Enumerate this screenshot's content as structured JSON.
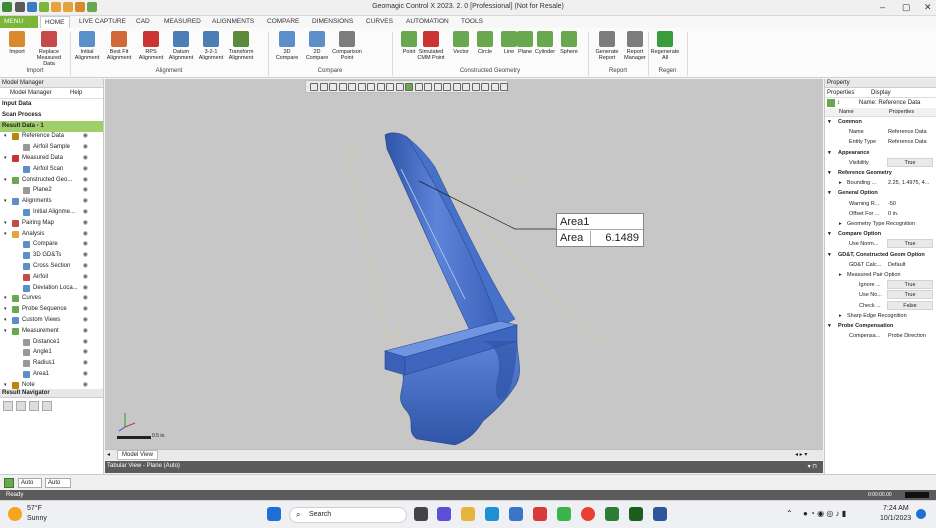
{
  "app": {
    "title": "Geomagic Control X 2023. 2. 0 [Professional] (Not for Resale)"
  },
  "tabs": [
    "MENU",
    "HOME",
    "LIVE CAPTURE",
    "CAD",
    "MEASURED",
    "ALIGNMENTS",
    "COMPARE",
    "DIMENSIONS",
    "CURVES",
    "AUTOMATION",
    "TOOLS"
  ],
  "ribbon": {
    "buttons": [
      {
        "label": "Import",
        "color": "#d98a2a"
      },
      {
        "label": "Replace Measured Data",
        "color": "#c74a4a"
      },
      {
        "label": "Initial Alignment",
        "color": "#5b8fc7"
      },
      {
        "label": "Best Fit Alignment",
        "color": "#d06a3a"
      },
      {
        "label": "RPS Alignment",
        "color": "#c33"
      },
      {
        "label": "Datum Alignment",
        "color": "#4a7fb5"
      },
      {
        "label": "3-2-1 Alignment",
        "color": "#4a7fb5"
      },
      {
        "label": "Transform Alignment",
        "color": "#5c8a3a"
      },
      {
        "label": "3D Compare",
        "color": "#5b8fc7"
      },
      {
        "label": "2D Compare",
        "color": "#5b8fc7"
      },
      {
        "label": "Comparison Point",
        "color": "#7d7d7d"
      },
      {
        "label": "Point",
        "color": "#6aa84f"
      },
      {
        "label": "Simulated CMM Point",
        "color": "#c33"
      },
      {
        "label": "Vector",
        "color": "#6aa84f"
      },
      {
        "label": "Circle",
        "color": "#6aa84f"
      },
      {
        "label": "Line",
        "color": "#6aa84f"
      },
      {
        "label": "Plane",
        "color": "#6aa84f"
      },
      {
        "label": "Cylinder",
        "color": "#6aa84f"
      },
      {
        "label": "Sphere",
        "color": "#6aa84f"
      },
      {
        "label": "Generate Report",
        "color": "#7d7d7d"
      },
      {
        "label": "Report Manager",
        "color": "#7d7d7d"
      },
      {
        "label": "Regenerate All",
        "color": "#3b9c3b"
      }
    ],
    "groups": [
      "Import",
      "Alignment",
      "Compare",
      "Constructed Geometry",
      "Report",
      "Regen"
    ]
  },
  "left_panel": {
    "title": "Model Manager",
    "tabs": [
      "Model Manager",
      "Help"
    ],
    "rows": [
      {
        "label": "Input Data",
        "type": "section"
      },
      {
        "label": "Scan Process",
        "type": "section"
      },
      {
        "label": "Result Data - 1",
        "type": "selected"
      },
      {
        "label": "Reference Data",
        "indent": 1,
        "color": "#b8860b"
      },
      {
        "label": "Airfoil Sample",
        "indent": 2,
        "color": "#999"
      },
      {
        "label": "Measured Data",
        "indent": 1,
        "color": "#c33"
      },
      {
        "label": "Airfoil Scan",
        "indent": 2,
        "color": "#5b8fc7"
      },
      {
        "label": "Constructed Geo...",
        "indent": 1,
        "color": "#6aa84f"
      },
      {
        "label": "Plane2",
        "indent": 2,
        "color": "#999"
      },
      {
        "label": "Alignments",
        "indent": 1,
        "color": "#5b8fc7"
      },
      {
        "label": "Initial Alignme...",
        "indent": 2,
        "color": "#5b8fc7"
      },
      {
        "label": "Pairing Map",
        "indent": 1,
        "color": "#c74a4a"
      },
      {
        "label": "Analysis",
        "indent": 1,
        "color": "#e6a23c"
      },
      {
        "label": "Compare",
        "indent": 2,
        "color": "#5b8fc7"
      },
      {
        "label": "3D GD&Ts",
        "indent": 2,
        "color": "#5b8fc7"
      },
      {
        "label": "Cross Section",
        "indent": 2,
        "color": "#5b8fc7"
      },
      {
        "label": "Airfoil",
        "indent": 2,
        "color": "#c74a4a"
      },
      {
        "label": "Deviation Loca...",
        "indent": 2,
        "color": "#5b8fc7"
      },
      {
        "label": "Curves",
        "indent": 1,
        "color": "#6aa84f"
      },
      {
        "label": "Probe Sequence",
        "indent": 1,
        "color": "#6aa84f"
      },
      {
        "label": "Custom Views",
        "indent": 1,
        "color": "#5b8fc7"
      },
      {
        "label": "Measurement",
        "indent": 1,
        "color": "#6aa84f"
      },
      {
        "label": "Distance1",
        "indent": 2,
        "color": "#999"
      },
      {
        "label": "Angle1",
        "indent": 2,
        "color": "#999"
      },
      {
        "label": "Radius1",
        "indent": 2,
        "color": "#999"
      },
      {
        "label": "Area1",
        "indent": 2,
        "color": "#5b8fc7"
      },
      {
        "label": "Note",
        "indent": 1,
        "color": "#b8860b"
      }
    ],
    "result_navigator": "Result Navigator"
  },
  "viewport": {
    "annotation": {
      "title": "Area1",
      "key": "Area",
      "value": "6.1489"
    },
    "scale_label": "0.5 in.",
    "tab": "Model View",
    "tabular": "Tabular View - Plane (Auto)"
  },
  "right_panel": {
    "title": "Property",
    "tabs": [
      "Properties",
      "Display"
    ],
    "name_label": "Name: Reference Data",
    "col_name": "Name",
    "col_props": "Properties",
    "rows": [
      {
        "type": "cat",
        "label": "Common"
      },
      {
        "label": "Name",
        "value": "Reference Data"
      },
      {
        "label": "Entity Type",
        "value": "Reference Data"
      },
      {
        "type": "cat",
        "label": "Appearance"
      },
      {
        "label": "Visibility",
        "value": "True",
        "box": true
      },
      {
        "type": "cat",
        "label": "Reference Geometry"
      },
      {
        "label": "Bounding ...",
        "value": "2.25, 1.4975, 4...",
        "expand": true
      },
      {
        "type": "cat",
        "label": "General Option"
      },
      {
        "label": "Warning R...",
        "value": "-50"
      },
      {
        "label": "Offset For ...",
        "value": "0 in."
      },
      {
        "label": "Geometry Type Recognition",
        "value": "",
        "expand": true
      },
      {
        "type": "cat",
        "label": "Compare Option"
      },
      {
        "label": "Use Norm...",
        "value": "True",
        "box": true
      },
      {
        "type": "cat",
        "label": "GD&T, Constructed Geom Option"
      },
      {
        "label": "GD&T Calc...",
        "value": "Default"
      },
      {
        "label": "Measured Pair Option",
        "value": "",
        "expand": true
      },
      {
        "label": "Ignore ...",
        "value": "True",
        "box": true,
        "deep": true
      },
      {
        "label": "Use No...",
        "value": "True",
        "box": true,
        "deep": true
      },
      {
        "label": "Check ...",
        "value": "False",
        "box": true,
        "deep": true
      },
      {
        "label": "Sharp Edge Recognition",
        "value": "",
        "expand": true
      },
      {
        "type": "cat",
        "label": "Probe Compensation"
      },
      {
        "label": "Compensa...",
        "value": "Probe Direction"
      }
    ]
  },
  "bottom": {
    "sel1": "Auto",
    "sel2": "Auto",
    "status": "Ready",
    "time_readout": "0:00:00.00"
  },
  "taskbar": {
    "weather_temp": "57°F",
    "weather_desc": "Sunny",
    "search": "Search",
    "time": "7:24 AM",
    "date": "10/1/2023"
  }
}
